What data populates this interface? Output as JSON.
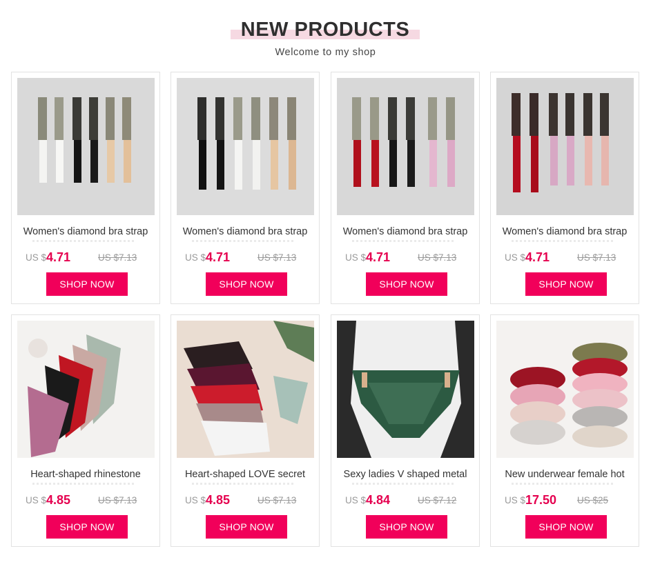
{
  "header": {
    "title": "NEW PRODUCTS",
    "subtitle": "Welcome to my shop"
  },
  "colors": {
    "accent": "#f1005a",
    "price": "#e5004f",
    "title_highlight": "#f6d9e2"
  },
  "products": [
    {
      "name": "Women's diamond bra strap",
      "currency": "US $",
      "price": "4.71",
      "old_price": "US $7.13",
      "button": "SHOP NOW",
      "image": "bra-straps-white-black-nude"
    },
    {
      "name": "Women's diamond bra strap",
      "currency": "US $",
      "price": "4.71",
      "old_price": "US $7.13",
      "button": "SHOP NOW",
      "image": "bra-straps-black-white-nude"
    },
    {
      "name": "Women's diamond bra strap",
      "currency": "US $",
      "price": "4.71",
      "old_price": "US $7.13",
      "button": "SHOP NOW",
      "image": "bra-straps-red-black-pink"
    },
    {
      "name": "Women's diamond bra strap",
      "currency": "US $",
      "price": "4.71",
      "old_price": "US $7.13",
      "button": "SHOP NOW",
      "image": "bra-straps-red-pink"
    },
    {
      "name": "Heart-shaped rhinestone",
      "currency": "US $",
      "price": "4.85",
      "old_price": "US $7.13",
      "button": "SHOP NOW",
      "image": "thongs-assorted"
    },
    {
      "name": "Heart-shaped LOVE secret",
      "currency": "US $",
      "price": "4.85",
      "old_price": "US $7.13",
      "button": "SHOP NOW",
      "image": "thongs-stacked"
    },
    {
      "name": "Sexy ladies V shaped metal",
      "currency": "US $",
      "price": "4.84",
      "old_price": "US $7.12",
      "button": "SHOP NOW",
      "image": "green-lace-panty-mannequin"
    },
    {
      "name": "New underwear female hot",
      "currency": "US $",
      "price": "17.50",
      "old_price": "US $25",
      "button": "SHOP NOW",
      "image": "bra-sets-assorted"
    }
  ]
}
